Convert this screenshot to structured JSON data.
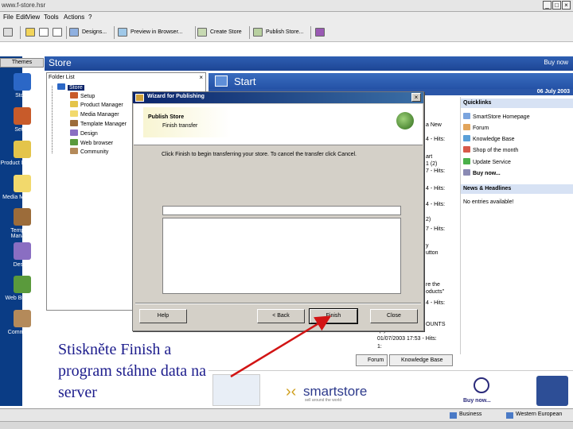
{
  "window": {
    "title": "www.f-store.hsr"
  },
  "menu": [
    "File",
    "Edit",
    "View",
    "Tools",
    "Actions",
    "?"
  ],
  "toolbar": {
    "designs": "Designs...",
    "preview": "Preview in Browser...",
    "create": "Create Store",
    "publish": "Publish Store..."
  },
  "left_panel": {
    "themes_tab": "Themes",
    "items": [
      {
        "label": "Store",
        "color": "#2b67c6"
      },
      {
        "label": "Setup",
        "color": "#c85b2a"
      },
      {
        "label": "Product Manager",
        "color": "#e4c44a"
      },
      {
        "label": "Media Manager",
        "color": "#f2d96c"
      },
      {
        "label": "Template Manager",
        "color": "#9c6c3a"
      },
      {
        "label": "Design",
        "color": "#8a6ec2"
      },
      {
        "label": "Web Browser",
        "color": "#5a9a3c"
      },
      {
        "label": "Community",
        "color": "#b48a5a"
      }
    ]
  },
  "store_header": {
    "title": "Store",
    "buy_now": "Buy now"
  },
  "folder_list": {
    "header": "Folder List",
    "items": [
      "Store",
      "Setup",
      "Product Manager",
      "Media Manager",
      "Template Manager",
      "Design",
      "Web browser",
      "Community"
    ]
  },
  "start": {
    "title": "Start",
    "date": "06 July 2003"
  },
  "middle_snippets": [
    "a New",
    "4 - Hits:",
    "art",
    "1 (2)",
    "7 - Hits:",
    "4 - Hits:",
    "4 - Hits:",
    "2)",
    "7 - Hits:",
    "y",
    "utton",
    "re the",
    "oducts\"",
    "4 - Hits:",
    "OUNTS",
    "(2)",
    "01/07/2003 17:53 - Hits:",
    "1:"
  ],
  "quicklinks": {
    "header": "Quicklinks",
    "items": [
      "SmartStore Homepage",
      "Forum",
      "Knowledge Base",
      "Shop of the month",
      "Update Service",
      "Buy now..."
    ],
    "news_header": "News & Headlines",
    "news_text": "No entries available!"
  },
  "bottom_tabs": [
    "Forum",
    "Knowledge Base"
  ],
  "banner": {
    "logo": "smartstore",
    "tagline": "sell around the world",
    "buy_now": "Buy now..."
  },
  "status": {
    "business": "Business",
    "locale": "Western European"
  },
  "dialog": {
    "title": "Wizard for Publishing",
    "header_title": "Publish Store",
    "header_sub": "Finish transfer",
    "message": "Click Finish to begin transferring your store. To cancel the transfer click Cancel.",
    "progress": 0,
    "buttons": {
      "help": "Help",
      "back": "< Back",
      "finish": "Finish",
      "close": "Close"
    }
  },
  "caption": {
    "line1": "Stiskněte Finish a",
    "line2": "program stáhne data na",
    "line3": "server"
  },
  "colors": {
    "caption": "#1c1c8c",
    "arrow": "#d21414",
    "header_blue": "#2452a6"
  }
}
